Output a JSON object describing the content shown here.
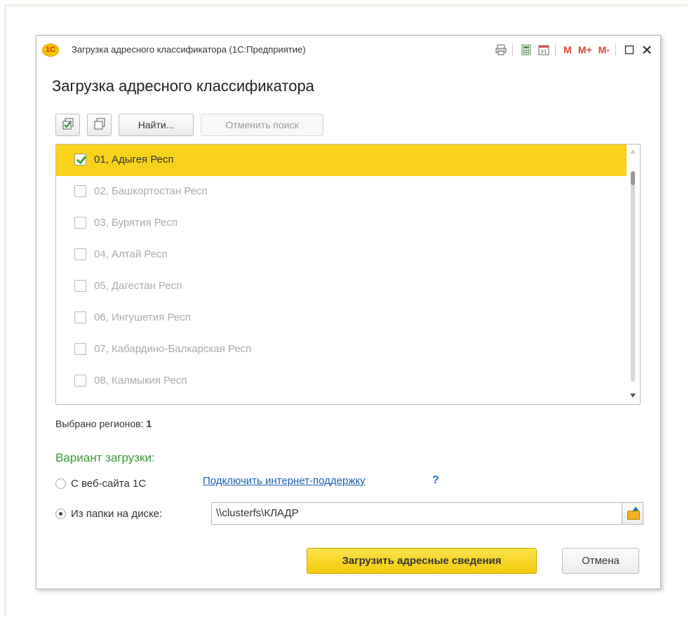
{
  "window": {
    "logo_text": "1C",
    "title": "Загрузка адресного классификатора  (1С:Предприятие)",
    "memory_buttons": [
      "M",
      "M+",
      "M-"
    ]
  },
  "form": {
    "title": "Загрузка адресного классификатора"
  },
  "toolbar": {
    "find_label": "Найти...",
    "cancel_search_label": "Отменить поиск"
  },
  "regions": [
    {
      "label": "01, Адыгея Респ",
      "checked": true
    },
    {
      "label": "02, Башкортостан Респ",
      "checked": false
    },
    {
      "label": "03, Бурятия Респ",
      "checked": false
    },
    {
      "label": "04, Алтай Респ",
      "checked": false
    },
    {
      "label": "05, Дагестан Респ",
      "checked": false
    },
    {
      "label": "06, Ингушетия Респ",
      "checked": false
    },
    {
      "label": "07, Кабардино-Балкарская Респ",
      "checked": false
    },
    {
      "label": "08, Калмыкия Респ",
      "checked": false
    }
  ],
  "selection": {
    "label": "Выбрано регионов:",
    "count": "1"
  },
  "load_variant": {
    "title": "Вариант загрузки:",
    "option_web": "С веб-сайта 1С",
    "connect_link": "Подключить интернет-поддержку",
    "help": "?",
    "option_folder": "Из папки на диске:",
    "folder_path": "\\\\clusterfs\\КЛАДР",
    "selected": "folder"
  },
  "actions": {
    "load_label": "Загрузить адресные сведения",
    "cancel_label": "Отмена"
  },
  "colors": {
    "selected_row": "#f9d21b",
    "section_title": "#3a9a3a",
    "link": "#1a5fb4",
    "primary_button": "#f3c90b"
  }
}
